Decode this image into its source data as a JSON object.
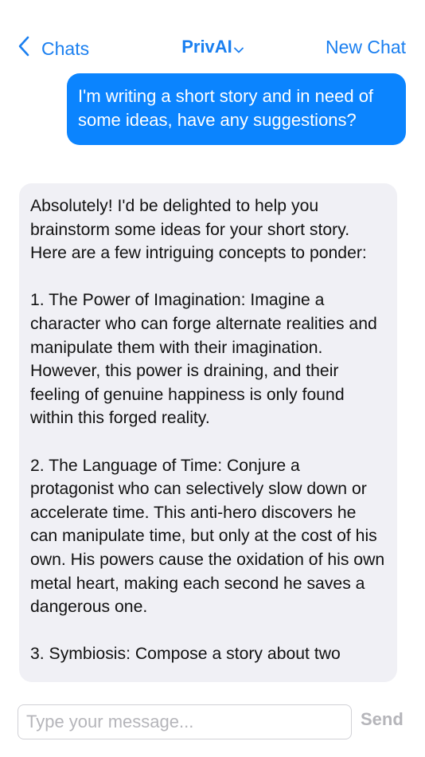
{
  "nav": {
    "back_label": "Chats",
    "title": "PrivAI",
    "new_chat_label": "New Chat"
  },
  "messages": [
    {
      "role": "user",
      "text": "I'm writing a short story and in need of some ideas, have any suggestions?"
    },
    {
      "role": "assistant",
      "text": "Absolutely! I'd be delighted to help you brainstorm some ideas for your short story. Here are a few intriguing concepts to ponder:\n\n1. The Power of Imagination: Imagine a character who can forge alternate realities and manipulate them with their imagination. However, this power is draining, and their feeling of genuine happiness is only found within this forged reality.\n\n2. The Language of Time: Conjure a protagonist who can selectively slow down or accelerate time. This anti-hero discovers he can manipulate time, but only at the cost of his own. His powers cause the oxidation of his own metal heart, making each second he saves a dangerous one.\n\n3. Symbiosis: Compose a story about two"
    }
  ],
  "composer": {
    "placeholder": "Type your message...",
    "value": "",
    "send_label": "Send"
  },
  "colors": {
    "accent": "#1a7ff0",
    "user_bubble": "#0b84fe",
    "assistant_bubble": "#f0f0f5",
    "disabled": "#b5b5ba"
  },
  "icons": {
    "back": "chevron-left-icon",
    "title_dropdown": "chevron-down-icon"
  }
}
